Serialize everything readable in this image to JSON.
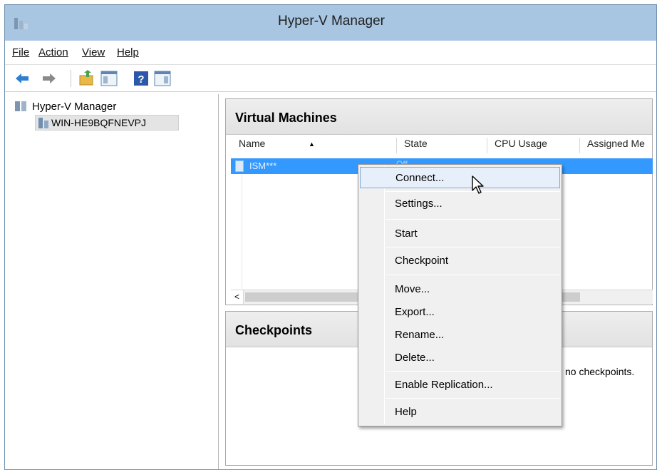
{
  "window": {
    "title": "Hyper-V Manager"
  },
  "menu": [
    "File",
    "Action",
    "View",
    "Help"
  ],
  "tree": {
    "root": "Hyper-V Manager",
    "server": "WIN-HE9BQFNEVPJ"
  },
  "vm_panel": {
    "title": "Virtual Machines",
    "columns": [
      "Name",
      "State",
      "CPU Usage",
      "Assigned Me"
    ],
    "rows": [
      {
        "name": "ISM***",
        "state": "Off"
      }
    ]
  },
  "checkpoints": {
    "title": "Checkpoints",
    "empty_text": "no checkpoints."
  },
  "context_menu": {
    "items": [
      "Connect...",
      "Settings...",
      "Start",
      "Checkpoint",
      "Move...",
      "Export...",
      "Rename...",
      "Delete...",
      "Enable Replication...",
      "Help"
    ],
    "highlighted": "Connect..."
  },
  "colors": {
    "title_bar": "#a8c5e2",
    "selection": "#3399ff",
    "menu_highlight": "#e7f0fa"
  },
  "icons": [
    "server-manager-icon",
    "back-arrow-icon",
    "forward-arrow-icon",
    "folder-up-icon",
    "show-hide-console-tree-icon",
    "help-icon",
    "action-pane-icon",
    "server-icon",
    "vm-icon",
    "cursor-icon"
  ]
}
